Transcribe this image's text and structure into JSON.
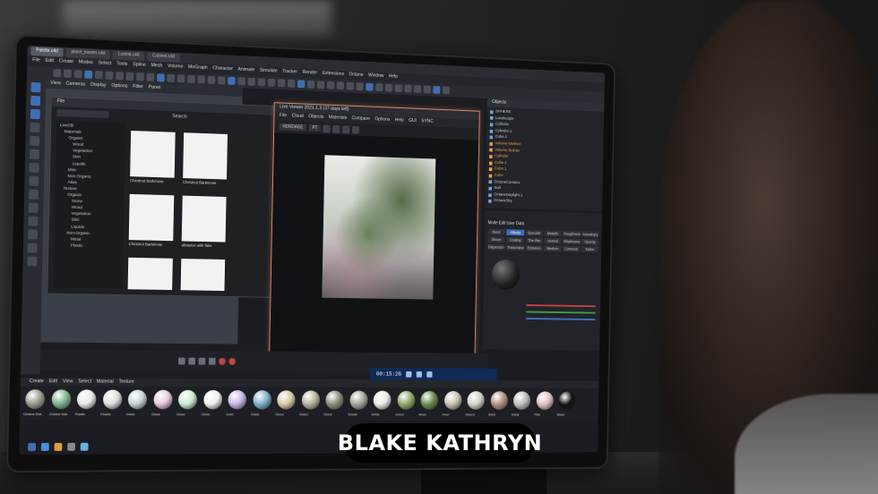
{
  "caption": {
    "name": "BLAKE KATHRYN"
  },
  "app": {
    "tabs": [
      "Palette.c4d",
      "planit_master.c4d",
      "Lustrat.c4d",
      "Cabinet.c4d"
    ],
    "menus": [
      "File",
      "Edit",
      "Create",
      "Modes",
      "Select",
      "Tools",
      "Spline",
      "Mesh",
      "Volume",
      "MoGraph",
      "Character",
      "Animate",
      "Simulate",
      "Tracker",
      "Render",
      "Extensions",
      "Octane",
      "Window",
      "Help"
    ],
    "viewport_menus": [
      "View",
      "Cameras",
      "Display",
      "Options",
      "Filter",
      "Panel"
    ]
  },
  "browser": {
    "title": "File",
    "search_label": "Search",
    "tree": [
      "LiveDB",
      "Materials",
      "Organic",
      "Wood",
      "Vegetation",
      "Skin",
      "Liquids",
      "Misc",
      "Non-Organic",
      "Atlas",
      "Texture",
      "Organic",
      "Stone",
      "Wood",
      "Vegetation",
      "Skin",
      "Liquids",
      "Non-Organic",
      "Metal",
      "Plastic"
    ],
    "captions": [
      "Chestnut Barkmose",
      "Chestnut Barkmose",
      "Chestnut Barkmose",
      "abrasive with fake"
    ]
  },
  "viewer": {
    "title": "Live Viewer 2021.1.3 (37 days left)",
    "menus": [
      "File",
      "Cloud",
      "Objects",
      "Materials",
      "Compare",
      "Options",
      "Help",
      "GUI",
      "SYNC"
    ],
    "mode": "HDRDAGE",
    "channel": "PT"
  },
  "render_time": "00:15:26",
  "objects_panel": {
    "title": "Objects",
    "rows": [
      {
        "label": "SPHERE",
        "orange": false
      },
      {
        "label": "Landscape",
        "orange": false
      },
      {
        "label": "Cylinder",
        "orange": false
      },
      {
        "label": "Cylinder.1",
        "orange": false
      },
      {
        "label": "Cube.1",
        "orange": false
      },
      {
        "label": "Volume Mesher",
        "orange": true
      },
      {
        "label": "Volume Builder",
        "orange": true
      },
      {
        "label": "Cylinder",
        "orange": true
      },
      {
        "label": "Cube.2",
        "orange": true
      },
      {
        "label": "Cube.1",
        "orange": true
      },
      {
        "label": "Cube",
        "orange": true
      },
      {
        "label": "OctaneCamera",
        "orange": false
      },
      {
        "label": "Null",
        "orange": false
      },
      {
        "label": "OctaneDaylight.1",
        "orange": false
      },
      {
        "label": "OctaneSky",
        "orange": false
      }
    ]
  },
  "attributes": {
    "header": "Mode  Edit  User Data",
    "cells": [
      "Basic",
      "Albedo",
      "Specular",
      "Metallic",
      "Roughness",
      "Anisotropy",
      "Sheen",
      "Coating",
      "Thin film",
      "Normal",
      "Displacement",
      "Opacity",
      "Dispersion",
      "Transmission",
      "Emission",
      "Medium",
      "Common",
      "Editor"
    ],
    "selected": 1
  },
  "material_menu": [
    "Create",
    "Edit",
    "View",
    "Select",
    "Material",
    "Texture"
  ],
  "materials": [
    {
      "label": "Octane Mat",
      "color": "#9aa08f"
    },
    {
      "label": "Octane Mat",
      "color": "#7fb58f"
    },
    {
      "label": "Plastic",
      "color": "#e8e8e8"
    },
    {
      "label": "Plastic",
      "color": "#dfdfdf"
    },
    {
      "label": "Glass",
      "color": "#c8d4d8"
    },
    {
      "label": "Glass",
      "color": "#e8c8e0"
    },
    {
      "label": "Gloss",
      "color": "#cdebd6"
    },
    {
      "label": "Gloss",
      "color": "#f0f0f0"
    },
    {
      "label": "Gold",
      "color": "#c8b8e8"
    },
    {
      "label": "Glass",
      "color": "#7fb0c8"
    },
    {
      "label": "Gloss",
      "color": "#d8c8a8"
    },
    {
      "label": "Water",
      "color": "#b8b49a"
    },
    {
      "label": "Stone",
      "color": "#8a8e7a"
    },
    {
      "label": "Terrain",
      "color": "#a4a69a"
    },
    {
      "label": "White",
      "color": "#eaeaea"
    },
    {
      "label": "Green",
      "color": "#8fa86a"
    },
    {
      "label": "Moss",
      "color": "#6a8a4a"
    },
    {
      "label": "Floor",
      "color": "#c8c0b0"
    },
    {
      "label": "Stucco",
      "color": "#d0d0c8"
    },
    {
      "label": "Brick",
      "color": "#b09080"
    },
    {
      "label": "Metal",
      "color": "#bcbcbc"
    },
    {
      "label": "Pink",
      "color": "#e0c0c8"
    },
    {
      "label": "Black",
      "color": "#101010"
    }
  ],
  "colors": {
    "accent": "#3f6fb3",
    "viewer_border": "#e08a6a",
    "caption_bg": "#000000"
  }
}
